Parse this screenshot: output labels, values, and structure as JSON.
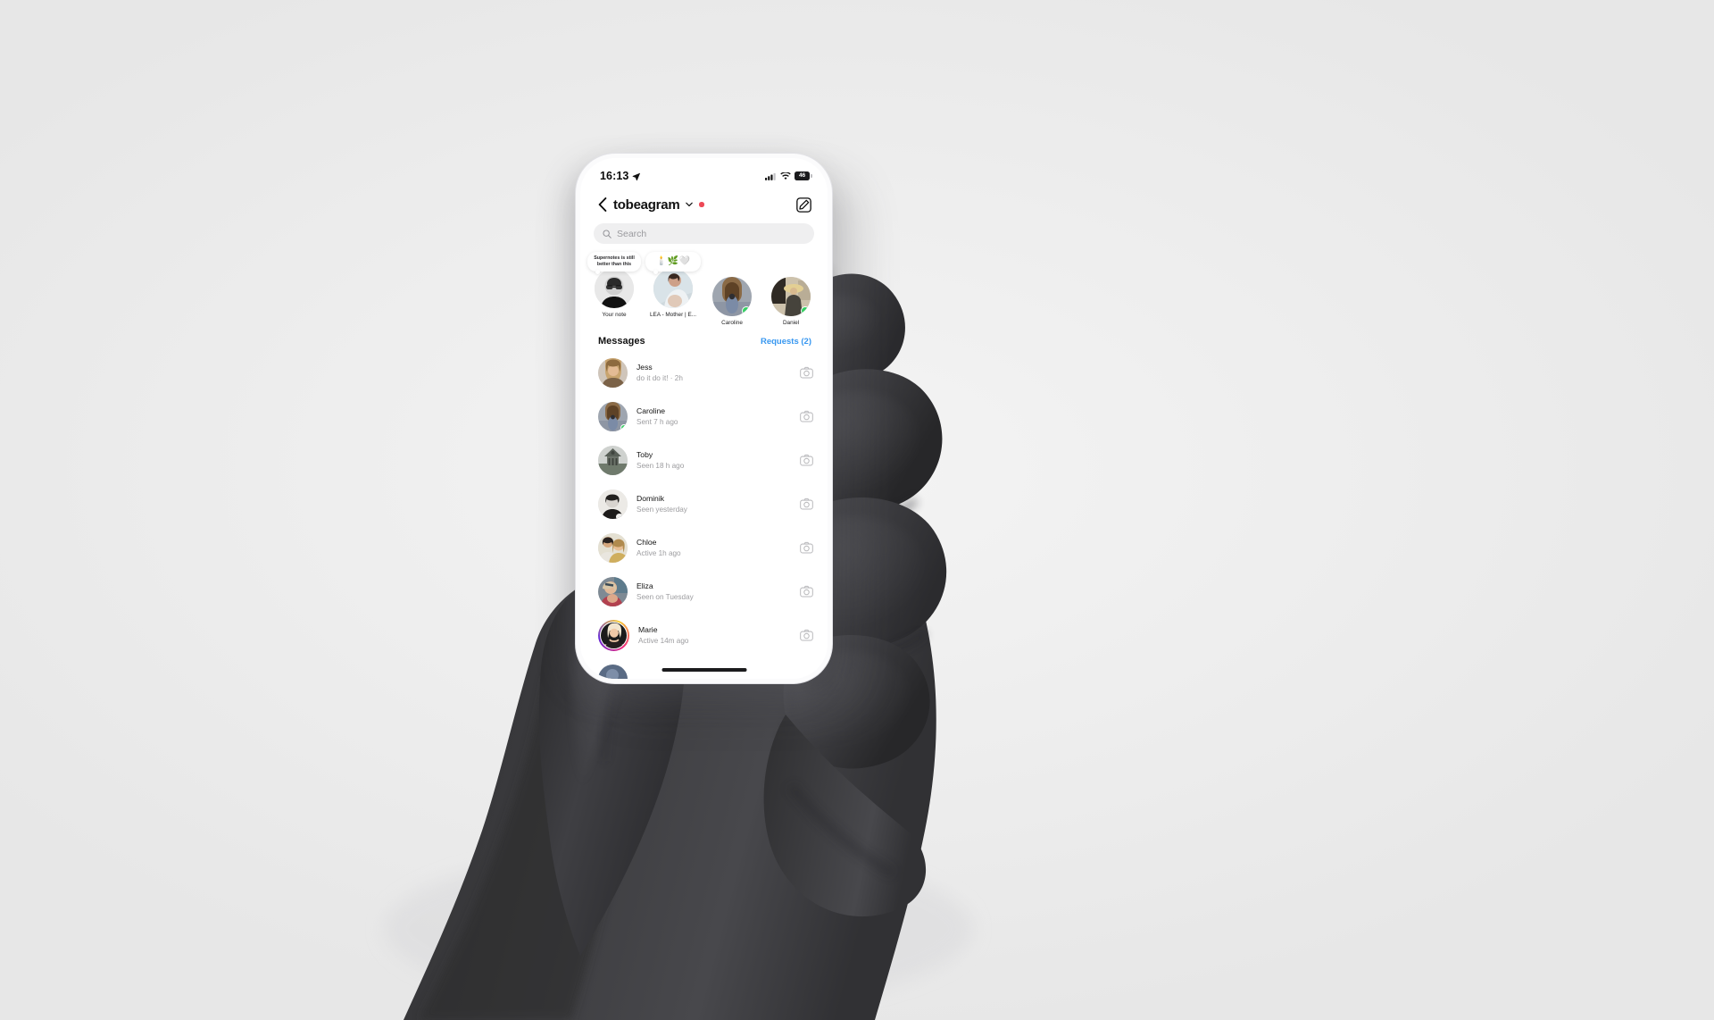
{
  "scene": {
    "background_color": "#efefef",
    "hand_color": "#3b3b3d",
    "phone_body_color": "#fbfbfc"
  },
  "status_bar": {
    "time": "16:13",
    "location_icon": "location-arrow-icon",
    "signal_icon": "cellular-signal-icon",
    "wifi_icon": "wifi-icon",
    "battery_level": "46",
    "battery_icon": "battery-icon"
  },
  "header": {
    "back_icon": "chevron-left-icon",
    "title": "tobeagram",
    "dropdown_icon": "chevron-down-icon",
    "unread_dot": "red-dot-badge",
    "compose_icon": "compose-pencil-icon"
  },
  "search": {
    "placeholder": "Search",
    "icon": "search-icon",
    "value": ""
  },
  "notes": {
    "items": [
      {
        "name": "Your note",
        "note_text": "Supernotes is still better than this",
        "note_type": "text",
        "online": false
      },
      {
        "name": "LEA - Mother | E...",
        "note_text": "🕯️🌿🤍",
        "note_type": "emoji",
        "online": false
      },
      {
        "name": "Caroline",
        "note_text": "",
        "note_type": "none",
        "online": true
      },
      {
        "name": "Daniel",
        "note_text": "",
        "note_type": "none",
        "online": true
      }
    ]
  },
  "messages_section": {
    "title": "Messages",
    "requests_label": "Requests (2)",
    "requests_color": "#3797f0",
    "camera_icon": "camera-icon",
    "rows": [
      {
        "name": "Jess",
        "status": "do it do it! · 2h",
        "online": false,
        "story_ring": false
      },
      {
        "name": "Caroline",
        "status": "Sent 7 h ago",
        "online": true,
        "story_ring": false
      },
      {
        "name": "Toby",
        "status": "Seen 18 h ago",
        "online": false,
        "story_ring": false
      },
      {
        "name": "Dominik",
        "status": "Seen yesterday",
        "online": false,
        "story_ring": false
      },
      {
        "name": "Chloe",
        "status": "Active 1h ago",
        "online": false,
        "story_ring": false
      },
      {
        "name": "Eliza",
        "status": "Seen on Tuesday",
        "online": false,
        "story_ring": false
      },
      {
        "name": "Marie",
        "status": "Active 14m ago",
        "online": false,
        "story_ring": true
      }
    ]
  },
  "home_indicator": "home-indicator-bar"
}
